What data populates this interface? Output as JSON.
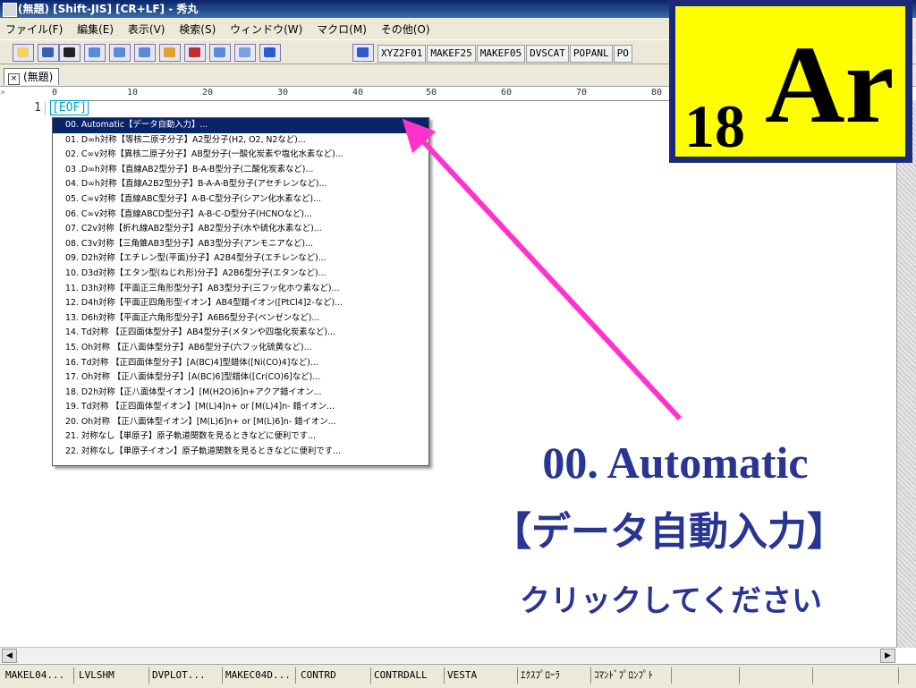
{
  "window": {
    "title": "(無題) [Shift-JIS] [CR+LF] - 秀丸"
  },
  "menu": [
    "ファイル(F)",
    "編集(E)",
    "表示(V)",
    "検索(S)",
    "ウィンドウ(W)",
    "マクロ(M)",
    "その他(O)"
  ],
  "toolbar": {
    "text_buttons": [
      "XYZ2F01",
      "MAKEF25",
      "MAKEF05",
      "DVSCAT",
      "POPANL",
      "PO"
    ]
  },
  "tab": {
    "label": "(無題)"
  },
  "ruler": {
    "marks": [
      "0",
      "10",
      "20",
      "30",
      "40",
      "50",
      "60",
      "70",
      "80"
    ]
  },
  "editor": {
    "line_number": "1",
    "eof": "[EOF]"
  },
  "dropdown": {
    "items": [
      "00. Automatic【データ自動入力】...",
      "01. D∞h対称【等核二原子分子】A2型分子(H2, O2, N2など)...",
      "02. C∞v対称【異核二原子分子】AB型分子(一酸化炭素や塩化水素など)...",
      "03 .D∞h対称【直線AB2型分子】B-A-B型分子(二酸化炭素など)...",
      "04. D∞h対称【直線A2B2型分子】B-A-A-B型分子(アセチレンなど)...",
      "05. C∞v対称【直線ABC型分子】A-B-C型分子(シアン化水素など)...",
      "06. C∞v対称【直線ABCD型分子】A-B-C-D型分子(HCNOなど)...",
      "07. C2v対称【折れ線AB2型分子】AB2型分子(水や硫化水素など)...",
      "08. C3v対称【三角錐AB3型分子】AB3型分子(アンモニアなど)...",
      "09. D2h対称【エチレン型(平面)分子】A2B4型分子(エチレンなど)...",
      "10. D3d対称【エタン型(ねじれ形)分子】A2B6型分子(エタンなど)...",
      "11. D3h対称【平面正三角形型分子】AB3型分子(三フッ化ホウ素など)...",
      "12. D4h対称【平面正四角形型イオン】AB4型錯イオン([PtCl4]2-など)...",
      "13. D6h対称【平面正六角形型分子】A6B6型分子(ベンゼンなど)...",
      "14. Td対称 【正四面体型分子】AB4型分子(メタンや四塩化炭素など)...",
      "15. Oh対称 【正八面体型分子】AB6型分子(六フッ化硫黄など)...",
      "16. Td対称 【正四面体型分子】[A(BC)4]型錯体([Ni(CO)4]など)...",
      "17. Oh対称 【正八面体型分子】[A(BC)6]型錯体([Cr(CO)6]など)...",
      "18. D2h対称【正八面体型イオン】[M(H2O)6]n+アクア錯イオン...",
      "19. Td対称 【正四面体型イオン】[M(L)4]n+ or [M(L)4]n- 錯イオン...",
      "20. Oh対称 【正八面体型イオン】[M(L)6]n+ or [M(L)6]n- 錯イオン...",
      "21. 対称なし【単原子】原子軌道関数を見るときなどに便利です...",
      "22. 対称なし【単原子イオン】原子軌道関数を見るときなどに便利です..."
    ]
  },
  "statusbar": [
    "MAKEL04...",
    "LVLSHM",
    "DVPLOT...",
    "MAKEC04D...",
    "CONTRD",
    "CONTRDALL",
    "VESTA",
    "ｴｸｽﾌﾟﾛｰﾗ",
    "ｺﾏﾝﾄﾞﾌﾟﾛﾝﾌﾟﾄ"
  ],
  "element_badge": {
    "atomic_number": "18",
    "symbol": "Ar"
  },
  "annotation": {
    "line1": "00. Automatic",
    "line2": "【データ自動入力】",
    "line3": "クリックしてください"
  },
  "colors": {
    "annotation_text": "#283593",
    "arrow": "#ff33cc",
    "badge_bg": "#ffff00",
    "badge_border": "#1b2a78",
    "selection": "#0a246a"
  }
}
